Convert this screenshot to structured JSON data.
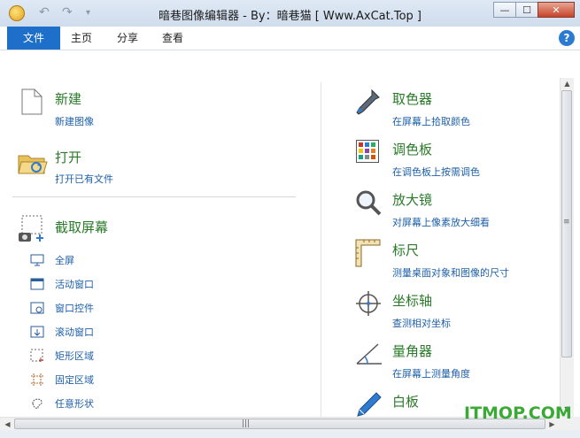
{
  "window": {
    "title": "暗巷图像编辑器 - By：暗巷猫 [ Www.AxCat.Top ]",
    "quick_access": [
      "↶",
      "↷",
      "▾"
    ],
    "buttons": {
      "minimize": "—",
      "maximize": "☐",
      "close": "✕"
    }
  },
  "menu": {
    "tabs": [
      {
        "label": "文件",
        "active": true
      },
      {
        "label": "主页",
        "active": false
      },
      {
        "label": "分享",
        "active": false
      },
      {
        "label": "查看",
        "active": false
      }
    ],
    "help": "?"
  },
  "left": {
    "new": {
      "title": "新建",
      "subtitle": "新建图像",
      "icon": "new-file-icon"
    },
    "open": {
      "title": "打开",
      "subtitle": "打开已有文件",
      "icon": "open-folder-icon"
    },
    "capture": {
      "title": "截取屏幕",
      "icon": "screen-capture-icon",
      "options": [
        {
          "label": "全屏",
          "icon": "monitor-icon"
        },
        {
          "label": "活动窗口",
          "icon": "window-icon"
        },
        {
          "label": "窗口控件",
          "icon": "window-control-icon"
        },
        {
          "label": "滚动窗口",
          "icon": "scroll-window-icon"
        },
        {
          "label": "矩形区域",
          "icon": "rectangle-region-icon"
        },
        {
          "label": "固定区域",
          "icon": "fixed-region-icon"
        },
        {
          "label": "任意形状",
          "icon": "freeform-icon"
        }
      ]
    }
  },
  "right": {
    "tools": [
      {
        "title": "取色器",
        "subtitle": "在屏幕上拾取颜色",
        "icon": "eyedropper-icon"
      },
      {
        "title": "调色板",
        "subtitle": "在调色板上按需调色",
        "icon": "palette-icon"
      },
      {
        "title": "放大镜",
        "subtitle": "对屏幕上像素放大细看",
        "icon": "magnifier-icon"
      },
      {
        "title": "标尺",
        "subtitle": "测量桌面对象和图像的尺寸",
        "icon": "ruler-icon"
      },
      {
        "title": "坐标轴",
        "subtitle": "查测相对坐标",
        "icon": "crosshair-icon"
      },
      {
        "title": "量角器",
        "subtitle": "在屏幕上测量角度",
        "icon": "protractor-icon"
      },
      {
        "title": "白板",
        "subtitle": "",
        "icon": "pen-icon"
      }
    ]
  },
  "scrollbars": {
    "grip": "≡",
    "hgrip": "|||"
  },
  "watermark": "ITMOP.COM"
}
